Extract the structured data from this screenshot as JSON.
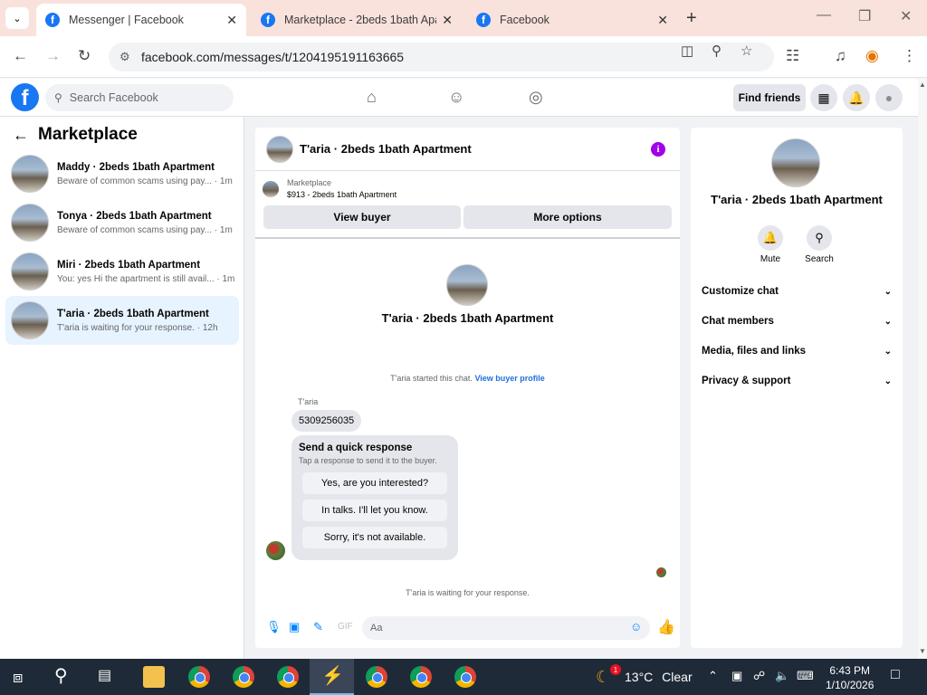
{
  "browser": {
    "tabs": [
      {
        "title": "Messenger | Facebook",
        "active": true
      },
      {
        "title": "Marketplace - 2beds 1bath Apa",
        "active": false
      },
      {
        "title": "Facebook",
        "active": false
      }
    ],
    "url": "facebook.com/messages/t/1204195191163665"
  },
  "fb": {
    "search_placeholder": "Search Facebook",
    "find_friends": "Find friends"
  },
  "sidebar": {
    "title": "Marketplace",
    "conversations": [
      {
        "name": "Maddy · 2beds 1bath Apartment",
        "preview": "Beware of common scams using pay... · 1m"
      },
      {
        "name": "Tonya · 2beds 1bath Apartment",
        "preview": "Beware of common scams using pay... · 1m"
      },
      {
        "name": "Miri · 2beds 1bath Apartment",
        "preview": "You: yes Hi the apartment is still avail... · 1m"
      },
      {
        "name": "T'aria · 2beds 1bath Apartment",
        "preview": "T'aria is waiting for your response. · 12h"
      }
    ]
  },
  "chat": {
    "title": "T'aria · 2beds 1bath Apartment",
    "listing_label": "Marketplace",
    "listing_price": "$913 - 2beds 1bath Apartment",
    "view_buyer": "View buyer",
    "more_options": "More options",
    "header_name": "T'aria · 2beds 1bath Apartment",
    "started_text": "T'aria started this chat.",
    "view_buyer_profile": "View buyer profile",
    "sender_name": "T'aria",
    "phone_message": "5309256035",
    "quick_title": "Send a quick response",
    "quick_subtitle": "Tap a response to send it to the buyer.",
    "quick_options": [
      "Yes, are you interested?",
      "In talks. I'll let you know.",
      "Sorry, it's not available."
    ],
    "waiting_text": "T'aria is waiting for your response.",
    "composer_placeholder": "Aa"
  },
  "info": {
    "name": "T'aria · 2beds 1bath Apartment",
    "mute_label": "Mute",
    "search_label": "Search",
    "sections": [
      "Customize chat",
      "Chat members",
      "Media, files and links",
      "Privacy & support"
    ]
  },
  "taskbar": {
    "weather_temp": "13°C",
    "weather_desc": "Clear",
    "weather_badge": "1",
    "time": "6:43 PM",
    "date": "1/10/2026"
  },
  "colors": {
    "fb_blue": "#1877f2",
    "messenger_accent": "#0084ff",
    "info_purple": "#a100e8",
    "selected_row": "#e7f3ff"
  }
}
